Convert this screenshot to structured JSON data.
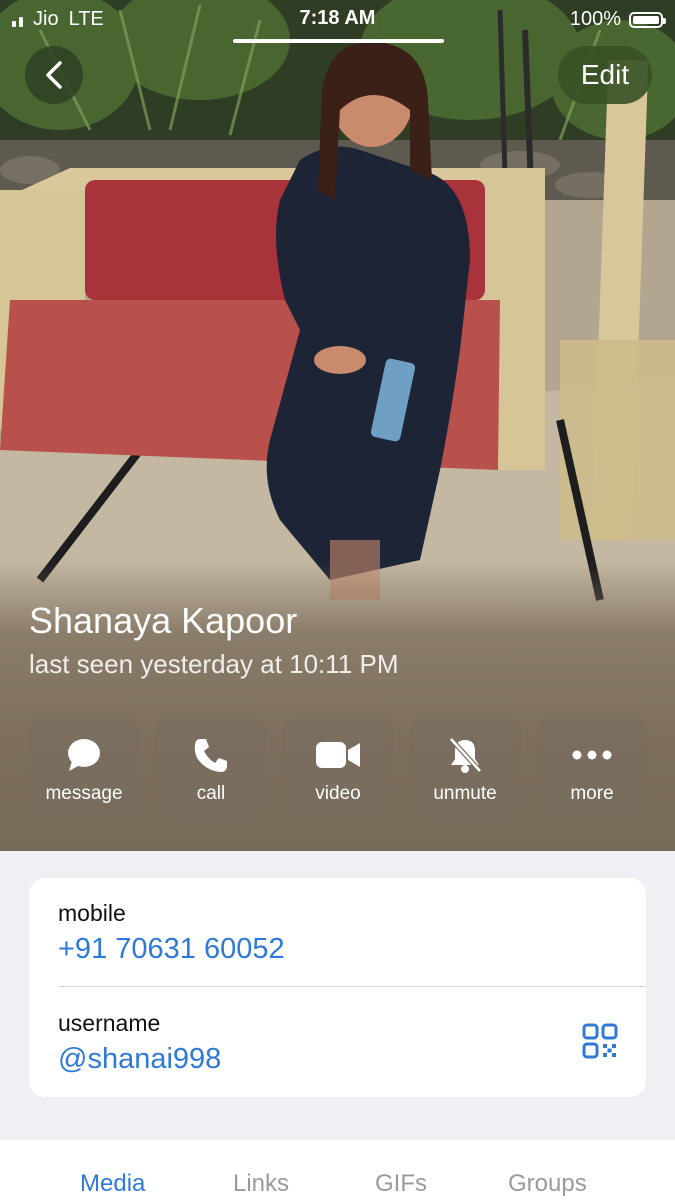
{
  "status_bar": {
    "carrier": "Jio",
    "network": "LTE",
    "time": "7:18 AM",
    "battery": "100%"
  },
  "nav": {
    "back_icon": "chevron-left-icon",
    "edit_label": "Edit"
  },
  "profile": {
    "name": "Shanaya Kapoor",
    "last_seen": "last seen yesterday at 10:11 PM"
  },
  "actions": [
    {
      "label": "message",
      "icon": "message-bubble-icon"
    },
    {
      "label": "call",
      "icon": "phone-icon"
    },
    {
      "label": "video",
      "icon": "video-camera-icon"
    },
    {
      "label": "unmute",
      "icon": "bell-slash-icon"
    },
    {
      "label": "more",
      "icon": "ellipsis-icon"
    }
  ],
  "info": {
    "mobile_label": "mobile",
    "mobile_value": "+91 70631 60052",
    "username_label": "username",
    "username_value": "@shanai998",
    "qr_icon": "qr-code-icon"
  },
  "tabs": [
    {
      "label": "Media",
      "active": true
    },
    {
      "label": "Links",
      "active": false
    },
    {
      "label": "GIFs",
      "active": false
    },
    {
      "label": "Groups",
      "active": false
    }
  ],
  "colors": {
    "accent": "#2f7ad8",
    "background": "#efeff4"
  }
}
